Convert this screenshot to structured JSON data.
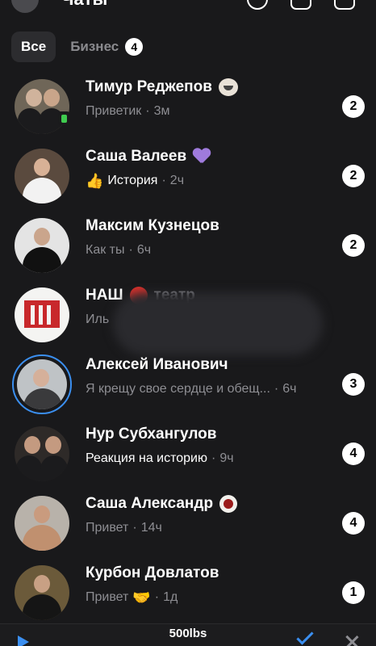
{
  "header": {
    "title": "Чаты"
  },
  "filters": [
    {
      "label": "Все",
      "active": true
    },
    {
      "label": "Бизнес",
      "badge": "4",
      "active": false
    }
  ],
  "chats": [
    {
      "name": "Тимур Реджепов",
      "preview": "Приветик",
      "time": "3м",
      "unread": "2",
      "emoji": "trollface"
    },
    {
      "name": "Саша Валеев",
      "preview": "История",
      "time": "2ч",
      "unread": "2",
      "emoji": "purple-heart",
      "preview_emoji": "👍"
    },
    {
      "name": "Максим Кузнецов",
      "preview": "Как ты",
      "time": "6ч",
      "unread": "2"
    },
    {
      "name": "НАШ",
      "name_suffix": "театр",
      "preview": "Иль",
      "time": "",
      "unread": ""
    },
    {
      "name": "Алексей Иванович",
      "preview": "Я крещу свое сердце и обещ...",
      "time": "6ч",
      "unread": "3"
    },
    {
      "name": "Нур Субхангулов",
      "preview": "Реакция на историю",
      "time": "9ч",
      "unread": "4"
    },
    {
      "name": "Саша Александр",
      "preview": "Привет",
      "time": "14ч",
      "unread": "4",
      "emoji": "chicken"
    },
    {
      "name": "Курбон Довлатов",
      "preview": "Привет",
      "time": "1д",
      "unread": "1",
      "preview_emoji": "🤝"
    }
  ],
  "player": {
    "title": "500lbs"
  },
  "colors": {
    "accent": "#3b8ff0",
    "background": "#19191b",
    "online": "#3fcb4f"
  }
}
